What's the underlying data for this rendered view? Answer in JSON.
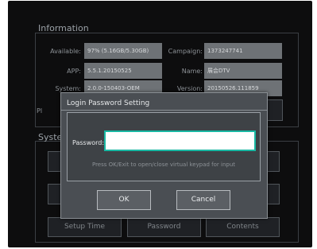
{
  "information": {
    "title": "Information",
    "rows": [
      {
        "label": "Available:",
        "value": "97% (5.16GB/5.30GB)",
        "label2": "Campaign:",
        "value2": "1373247741"
      },
      {
        "label": "APP:",
        "value": "5.5.1.20150525",
        "label2": "Name:",
        "value2": "展会DTV"
      },
      {
        "label": "System:",
        "value": "2.0.0-150403-OEM",
        "label2": "Version:",
        "value2": "20150526.111859"
      }
    ],
    "partial_label": "Pl"
  },
  "system": {
    "title": "Syste",
    "buttons": [
      "Setup Time",
      "Password",
      "Contents"
    ]
  },
  "dialog": {
    "title": "Login Password Setting",
    "password_label": "Password:",
    "password_value": "",
    "hint": "Press OK/Exit to open/close virtual keypad for input",
    "ok_label": "OK",
    "cancel_label": "Cancel"
  },
  "colors": {
    "accent": "#19b8a3",
    "background": "#0d0d0e"
  }
}
